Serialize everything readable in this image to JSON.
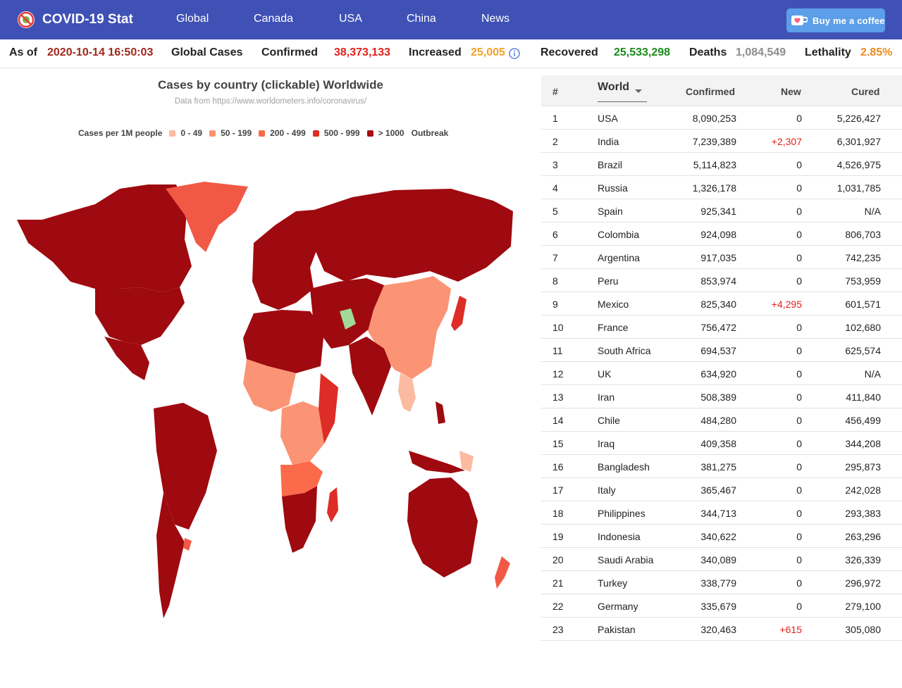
{
  "header": {
    "app_title": "COVID-19 Stat",
    "nav": [
      "Global",
      "Canada",
      "USA",
      "China",
      "News"
    ],
    "coffee_label": "Buy me a coffee",
    "colors": {
      "nav_bg": "#3f51b5",
      "coffee_bg": "#5c9ee8"
    }
  },
  "stats": {
    "as_of_label": "As of",
    "as_of_value": "2020-10-14 16:50:03",
    "global_cases_label": "Global Cases",
    "confirmed_label": "Confirmed",
    "confirmed_value": "38,373,133",
    "increased_label": "Increased",
    "increased_value": "25,005",
    "recovered_label": "Recovered",
    "recovered_value": "25,533,298",
    "deaths_label": "Deaths",
    "deaths_value": "1,084,549",
    "lethality_label": "Lethality",
    "lethality_value": "2.85%"
  },
  "map": {
    "title": "Cases by country (clickable) Worldwide",
    "source": "Data from https://www.worldometers.info/coronavirus/",
    "legend_title": "Cases per 1M people",
    "legend": [
      {
        "label": "0 - 49",
        "color": "#fcbba1"
      },
      {
        "label": "50 - 199",
        "color": "#fc9272"
      },
      {
        "label": "200 - 499",
        "color": "#fb6a4a"
      },
      {
        "label": "500 - 999",
        "color": "#de2d26"
      },
      {
        "label": "> 1000",
        "color": "#a50f15"
      }
    ],
    "legend_extra": "Outbreak"
  },
  "table": {
    "headers": {
      "rank": "#",
      "region": "World",
      "confirmed": "Confirmed",
      "new": "New",
      "cured": "Cured"
    },
    "rows": [
      {
        "rank": "1",
        "country": "USA",
        "confirmed": "8,090,253",
        "new": "0",
        "cured": "5,226,427"
      },
      {
        "rank": "2",
        "country": "India",
        "confirmed": "7,239,389",
        "new": "+2,307",
        "cured": "6,301,927"
      },
      {
        "rank": "3",
        "country": "Brazil",
        "confirmed": "5,114,823",
        "new": "0",
        "cured": "4,526,975"
      },
      {
        "rank": "4",
        "country": "Russia",
        "confirmed": "1,326,178",
        "new": "0",
        "cured": "1,031,785"
      },
      {
        "rank": "5",
        "country": "Spain",
        "confirmed": "925,341",
        "new": "0",
        "cured": "N/A"
      },
      {
        "rank": "6",
        "country": "Colombia",
        "confirmed": "924,098",
        "new": "0",
        "cured": "806,703"
      },
      {
        "rank": "7",
        "country": "Argentina",
        "confirmed": "917,035",
        "new": "0",
        "cured": "742,235"
      },
      {
        "rank": "8",
        "country": "Peru",
        "confirmed": "853,974",
        "new": "0",
        "cured": "753,959"
      },
      {
        "rank": "9",
        "country": "Mexico",
        "confirmed": "825,340",
        "new": "+4,295",
        "cured": "601,571"
      },
      {
        "rank": "10",
        "country": "France",
        "confirmed": "756,472",
        "new": "0",
        "cured": "102,680"
      },
      {
        "rank": "11",
        "country": "South Africa",
        "confirmed": "694,537",
        "new": "0",
        "cured": "625,574"
      },
      {
        "rank": "12",
        "country": "UK",
        "confirmed": "634,920",
        "new": "0",
        "cured": "N/A"
      },
      {
        "rank": "13",
        "country": "Iran",
        "confirmed": "508,389",
        "new": "0",
        "cured": "411,840"
      },
      {
        "rank": "14",
        "country": "Chile",
        "confirmed": "484,280",
        "new": "0",
        "cured": "456,499"
      },
      {
        "rank": "15",
        "country": "Iraq",
        "confirmed": "409,358",
        "new": "0",
        "cured": "344,208"
      },
      {
        "rank": "16",
        "country": "Bangladesh",
        "confirmed": "381,275",
        "new": "0",
        "cured": "295,873"
      },
      {
        "rank": "17",
        "country": "Italy",
        "confirmed": "365,467",
        "new": "0",
        "cured": "242,028"
      },
      {
        "rank": "18",
        "country": "Philippines",
        "confirmed": "344,713",
        "new": "0",
        "cured": "293,383"
      },
      {
        "rank": "19",
        "country": "Indonesia",
        "confirmed": "340,622",
        "new": "0",
        "cured": "263,296"
      },
      {
        "rank": "20",
        "country": "Saudi Arabia",
        "confirmed": "340,089",
        "new": "0",
        "cured": "326,339"
      },
      {
        "rank": "21",
        "country": "Turkey",
        "confirmed": "338,779",
        "new": "0",
        "cured": "296,972"
      },
      {
        "rank": "22",
        "country": "Germany",
        "confirmed": "335,679",
        "new": "0",
        "cured": "279,100"
      },
      {
        "rank": "23",
        "country": "Pakistan",
        "confirmed": "320,463",
        "new": "+615",
        "cured": "305,080"
      }
    ]
  }
}
